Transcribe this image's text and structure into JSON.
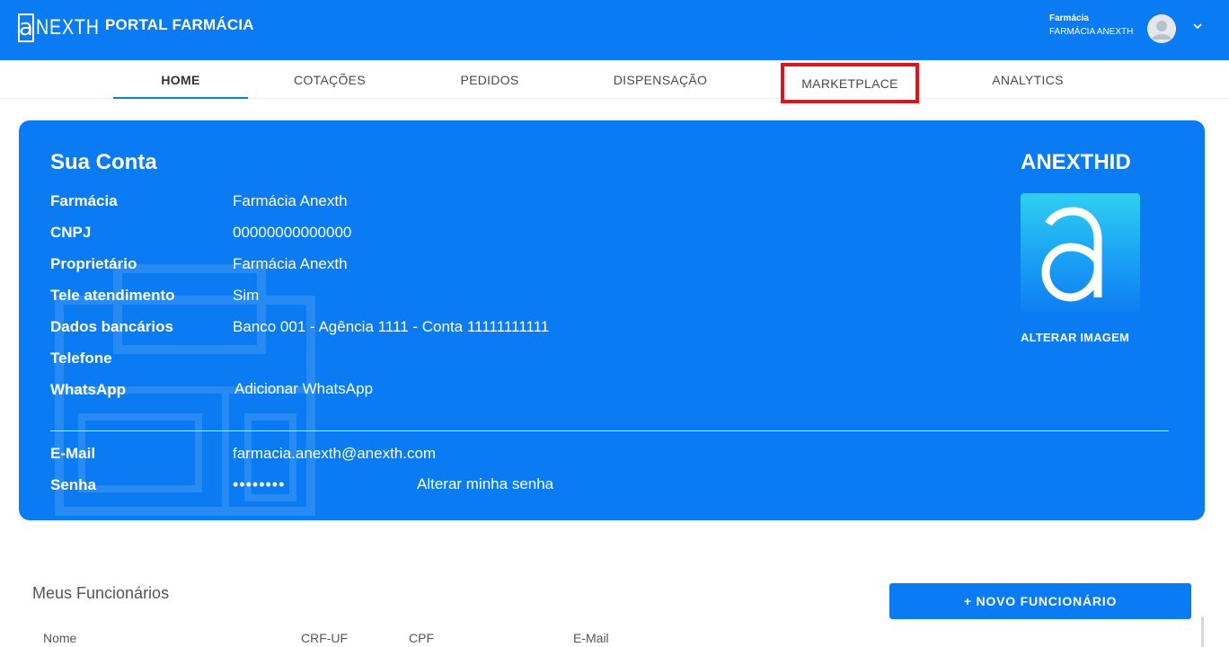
{
  "header": {
    "logo_text": "NEXTH",
    "portal_title": "PORTAL FARMÁCIA",
    "user_role": "Farmácia",
    "user_name": "FARMÁCIA ANEXTH"
  },
  "nav": {
    "tabs": [
      {
        "label": "HOME",
        "active": true
      },
      {
        "label": "COTAÇÕES",
        "active": false
      },
      {
        "label": "PEDIDOS",
        "active": false
      },
      {
        "label": "DISPENSAÇÃO",
        "active": false
      },
      {
        "label": "MARKETPLACE",
        "active": false,
        "highlighted": true
      },
      {
        "label": "ANALYTICS",
        "active": false
      }
    ]
  },
  "account": {
    "title": "Sua Conta",
    "fields": [
      {
        "label": "Farmácia",
        "value": "Farmácia Anexth"
      },
      {
        "label": "CNPJ",
        "value": "00000000000000"
      },
      {
        "label": "Proprietário",
        "value": "Farmácia Anexth"
      },
      {
        "label": "Tele atendimento",
        "value": "Sim"
      },
      {
        "label": "Dados bancários",
        "value": "Banco 001 - Agência 1111 - Conta 11111111111"
      },
      {
        "label": "Telefone",
        "value": ""
      },
      {
        "label": "WhatsApp",
        "value": "Adicionar WhatsApp"
      }
    ],
    "email_label": "E-Mail",
    "email_value": "farmacia.anexth@anexth.com",
    "password_label": "Senha",
    "password_value": "••••••••",
    "change_password": "Alterar minha senha",
    "id_title": "ANEXTHID",
    "change_image": "ALTERAR IMAGEM"
  },
  "employees": {
    "title": "Meus Funcionários",
    "new_button": "+ NOVO FUNCIONÁRIO",
    "columns": [
      "Nome",
      "CRF-UF",
      "CPF",
      "E-Mail"
    ]
  },
  "colors": {
    "brand_blue": "#0a7bf2",
    "highlight_red": "#e0141e"
  },
  "icons": [
    "anexth-logo-icon",
    "user-avatar-icon",
    "chevron-down-icon",
    "anexth-id-logo-icon",
    "pharmacy-watermark-icon"
  ]
}
